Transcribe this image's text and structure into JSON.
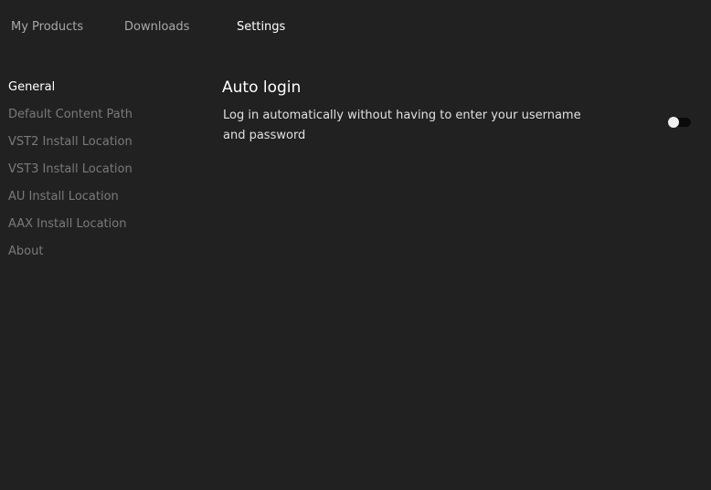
{
  "tabs": [
    "My Products",
    "Downloads",
    "Settings"
  ],
  "sidebar": [
    "General",
    "Default Content Path",
    "VST2 Install Location",
    "VST3 Install Location",
    "AU Install Location",
    "AAX Install Location",
    "About"
  ],
  "setting": {
    "title": "Auto login",
    "description": "Log in automatically without having to enter your username and password",
    "enabled": false
  }
}
